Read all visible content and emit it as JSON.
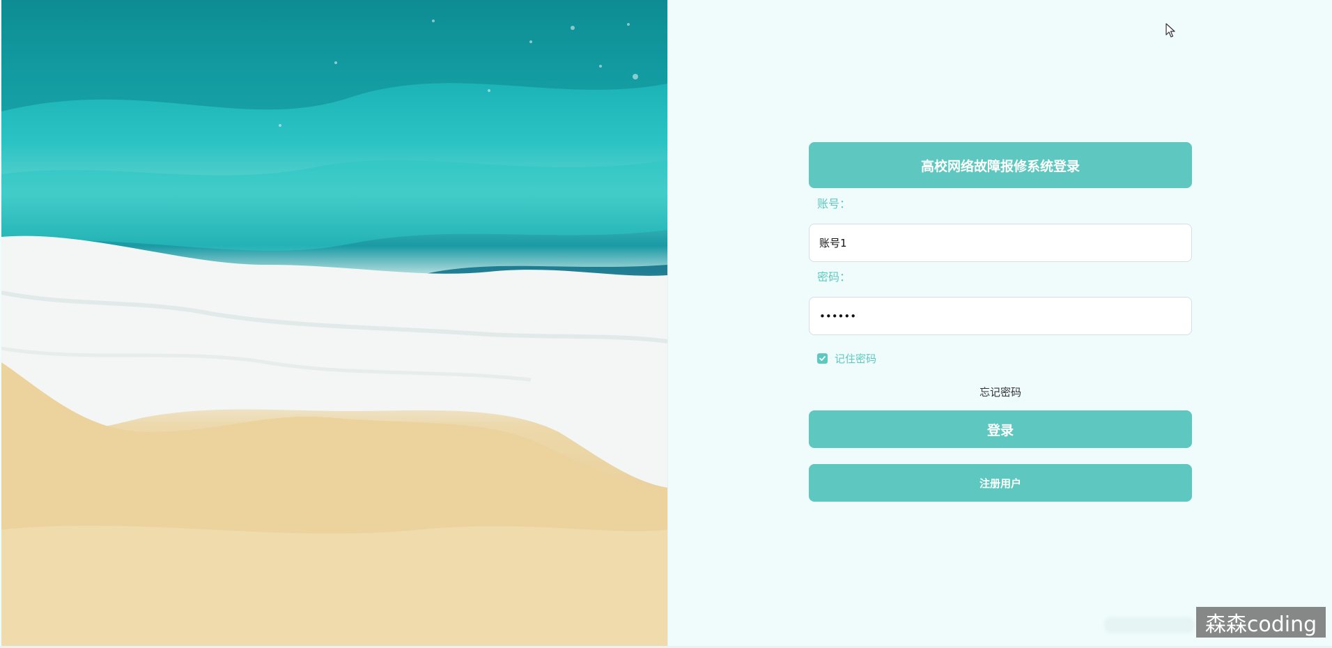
{
  "login": {
    "title": "高校网络故障报修系统登录",
    "account_label": "账号：",
    "account_value": "账号1",
    "password_label": "密码：",
    "password_value": "123456",
    "remember_label": "记住密码",
    "remember_checked": true,
    "forgot_label": "忘记密码",
    "login_button": "登录",
    "register_button": "注册用户"
  },
  "watermark": "森森coding",
  "colors": {
    "accent": "#5ec8c0",
    "page_bg": "#f0fcfc"
  }
}
